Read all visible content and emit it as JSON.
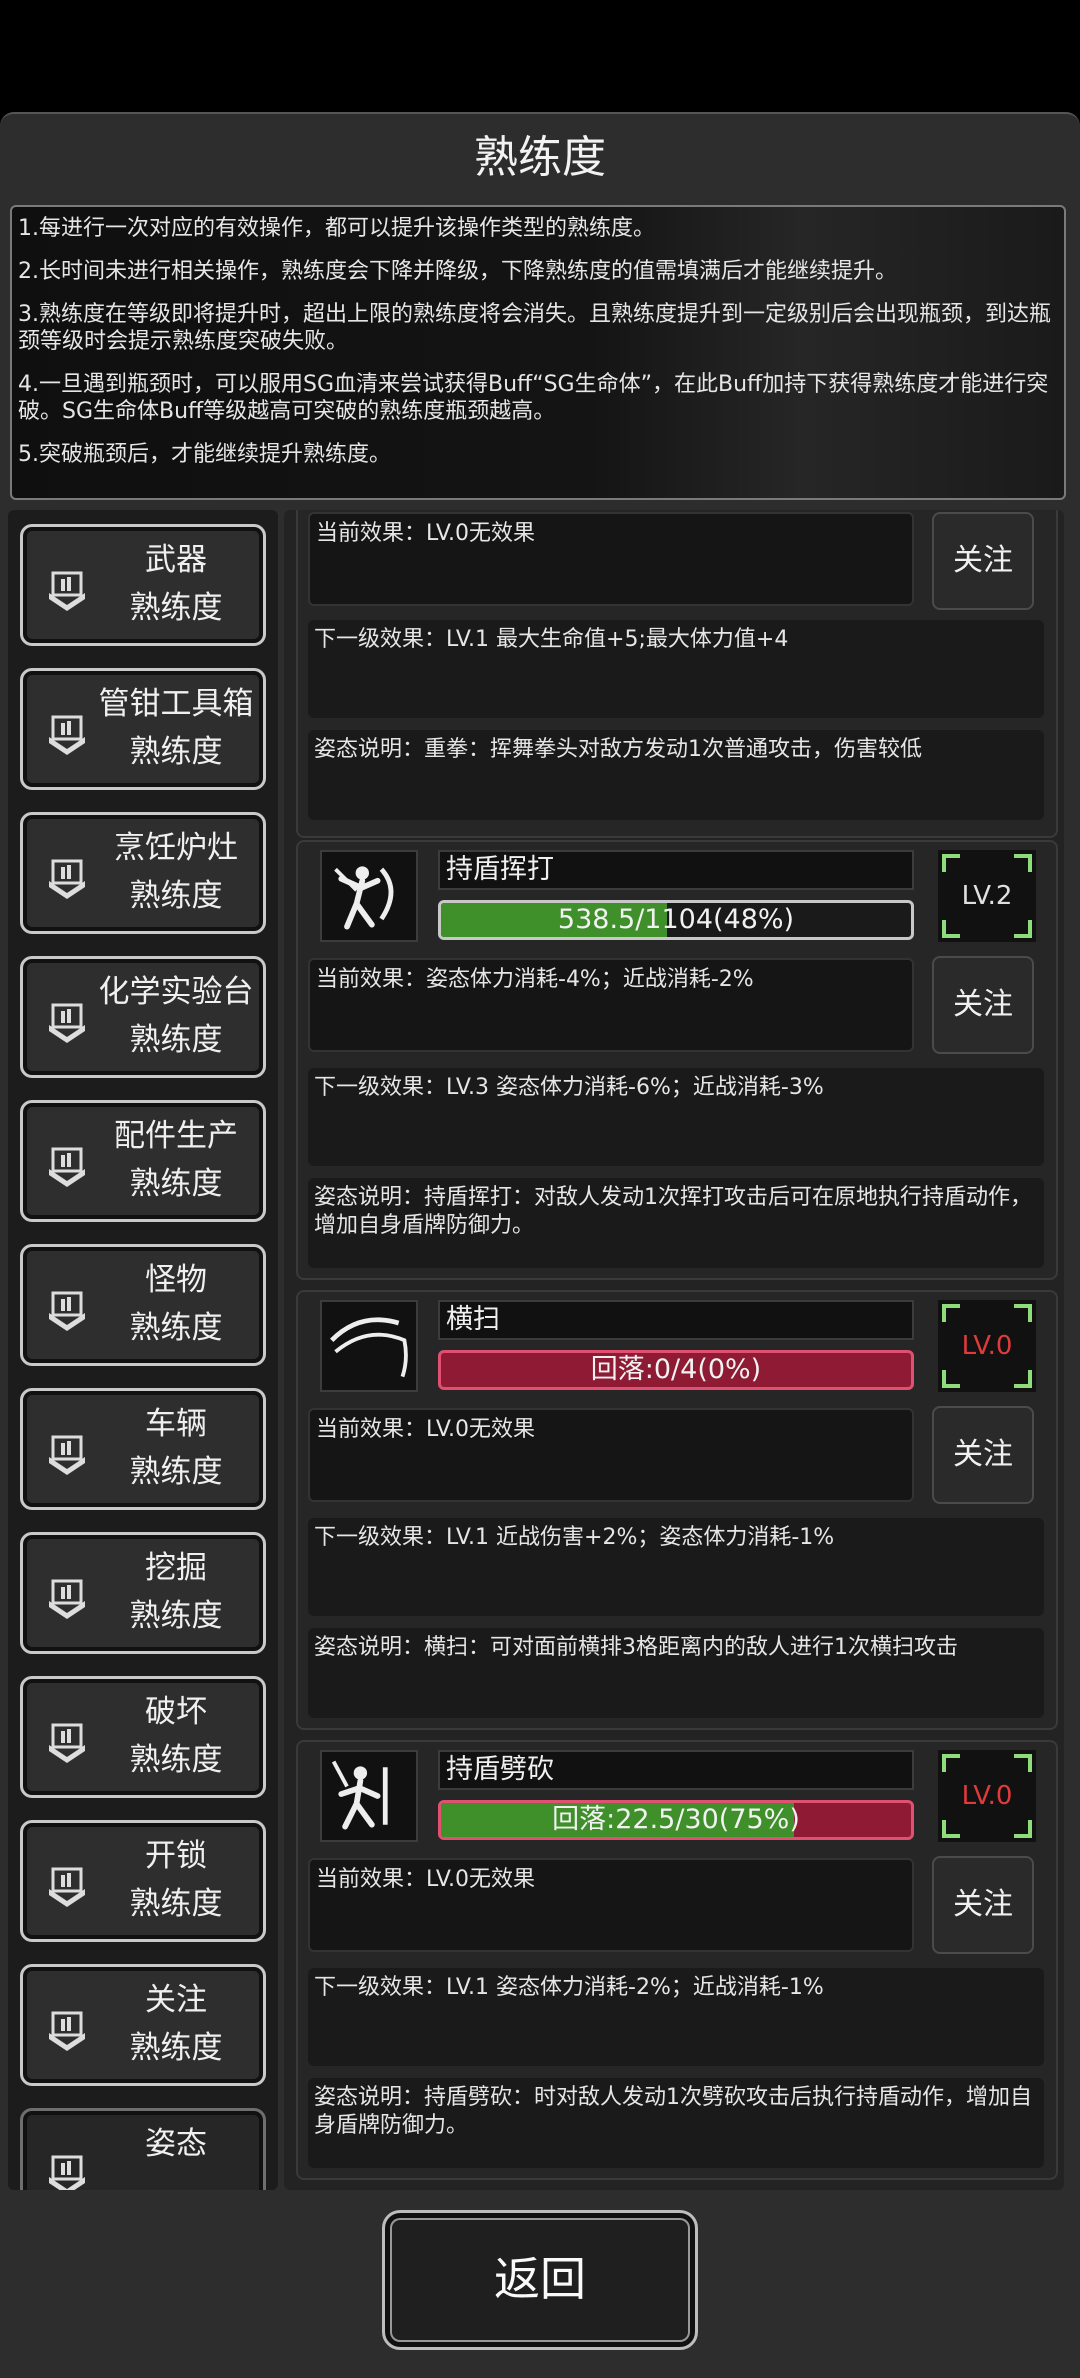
{
  "header": {
    "title": "熟练度"
  },
  "info": [
    "1.每进行一次对应的有效操作，都可以提升该操作类型的熟练度。",
    "2.长时间未进行相关操作，熟练度会下降并降级，下降熟练度的值需填满后才能继续提升。",
    "3.熟练度在等级即将提升时，超出上限的熟练度将会消失。且熟练度提升到一定级别后会出现瓶颈，到达瓶颈等级时会提示熟练度突破失败。",
    "4.一旦遇到瓶颈时，可以服用SG血清来尝试获得Buff“SG生命体”，在此Buff加持下获得熟练度才能进行突破。SG生命体Buff等级越高可突破的熟练度瓶颈越高。",
    "5.突破瓶颈后，才能继续提升熟练度。"
  ],
  "sidebar": {
    "items": [
      {
        "line1": "武器",
        "line2": "熟练度"
      },
      {
        "line1": "管钳工具箱",
        "line2": "熟练度"
      },
      {
        "line1": "烹饪炉灶",
        "line2": "熟练度"
      },
      {
        "line1": "化学实验台",
        "line2": "熟练度"
      },
      {
        "line1": "配件生产",
        "line2": "熟练度"
      },
      {
        "line1": "怪物",
        "line2": "熟练度"
      },
      {
        "line1": "车辆",
        "line2": "熟练度"
      },
      {
        "line1": "挖掘",
        "line2": "熟练度"
      },
      {
        "line1": "破坏",
        "line2": "熟练度"
      },
      {
        "line1": "开锁",
        "line2": "熟练度"
      },
      {
        "line1": "关注",
        "line2": "熟练度"
      },
      {
        "line1": "姿态",
        "line2": ""
      }
    ]
  },
  "follow_label": "关注",
  "top_card": {
    "current": "当前效果：LV.0无效果",
    "next": "下一级效果：LV.1 最大生命值+5;最大体力值+4",
    "desc": "姿态说明：重拳：挥舞拳头对敌方发动1次普通攻击，伤害较低"
  },
  "skills": [
    {
      "name": "持盾挥打",
      "bar_text": "538.5/1104(48%)",
      "progress": 0.48,
      "bar_style": "normal",
      "level": "LV.2",
      "current": "当前效果：姿态体力消耗-4%；近战消耗-2%",
      "next": "下一级效果：LV.3 姿态体力消耗-6%；近战消耗-3%",
      "desc": "姿态说明：持盾挥打：对敌人发动1次挥打攻击后可在原地执行持盾动作，增加自身盾牌防御力。"
    },
    {
      "name": "横扫",
      "bar_text": "回落:0/4(0%)",
      "progress": 0,
      "bar_style": "fallback",
      "level": "LV.0",
      "current": "当前效果：LV.0无效果",
      "next": "下一级效果：LV.1 近战伤害+2%；姿态体力消耗-1%",
      "desc": "姿态说明：横扫：可对面前横排3格距离内的敌人进行1次横扫攻击"
    },
    {
      "name": "持盾劈砍",
      "bar_text": "回落:22.5/30(75%)",
      "progress": 0.75,
      "bar_style": "fallback",
      "level": "LV.0",
      "current": "当前效果：LV.0无效果",
      "next": "下一级效果：LV.1 姿态体力消耗-2%；近战消耗-1%",
      "desc": "姿态说明：持盾劈砍：时对敌人发动1次劈砍攻击后执行持盾动作，增加自身盾牌防御力。"
    }
  ],
  "footer": {
    "back_label": "返回"
  },
  "colors": {
    "progress_green": "#3f8f2a",
    "fallback_red": "#8e1a33",
    "level_red": "#e03a3a",
    "corner_green": "#8fdc7a"
  }
}
